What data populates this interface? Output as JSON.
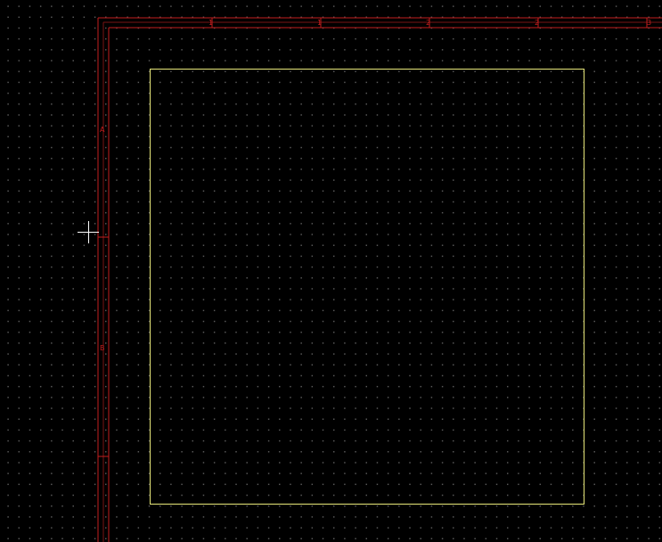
{
  "editor": {
    "background_color": "#000000",
    "grid_dot_color": "#5a5a5a",
    "sheet_border_color": "#c41e1e",
    "board_outline_color": "#e8e87a",
    "cursor_color": "#ffffff"
  },
  "sheet": {
    "column_labels": [
      "1",
      "1",
      "2",
      "2",
      "3"
    ],
    "row_labels": [
      "A",
      "B"
    ]
  }
}
